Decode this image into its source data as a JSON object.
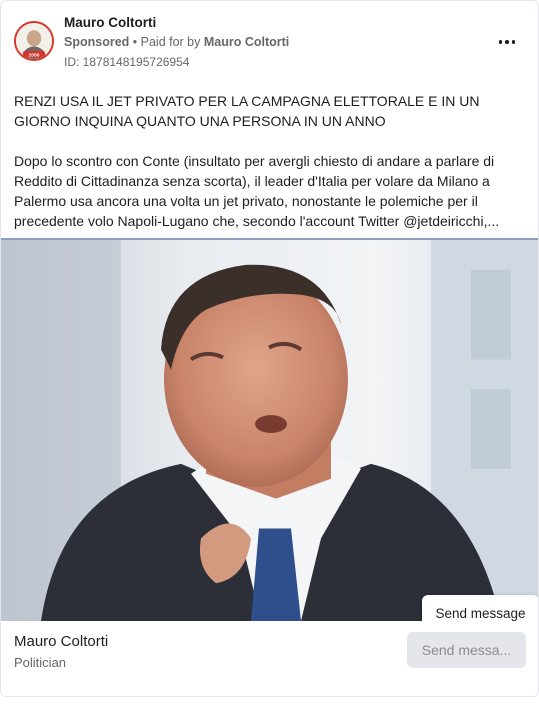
{
  "ad": {
    "advertiser": "Mauro Coltorti",
    "sponsored_label": "Sponsored",
    "separator": " • ",
    "paid_for_prefix": "Paid for by ",
    "paid_for_name": "Mauro Coltorti",
    "ad_id": "ID: 1878148195726954",
    "more_icon": "more-horizontal-icon",
    "avatar_badge": "2050",
    "headline": "RENZI USA IL JET PRIVATO PER LA CAMPAGNA ELETTORALE E IN UN GIORNO INQUINA QUANTO UNA PERSONA IN UN ANNO",
    "body": "Dopo lo scontro con Conte (insultato per avergli chiesto di andare a parlare di Reddito di Cittadinanza senza scorta), il leader d'Italia per volare da Milano a Palermo usa ancora una volta un jet privato, nonostante le polemiche per il precedente volo Napoli-Lugano che, secondo l'account Twitter @jetdeiricchi,..."
  },
  "tooltip": {
    "text": "Send message"
  },
  "footer": {
    "page_name": "Mauro Coltorti",
    "page_category": "Politician",
    "cta_label": "Send messa..."
  },
  "colors": {
    "accent_red": "#d9342b",
    "text_primary": "#1c1e21",
    "text_secondary": "#65676b",
    "button_bg": "#e4e6eb"
  }
}
